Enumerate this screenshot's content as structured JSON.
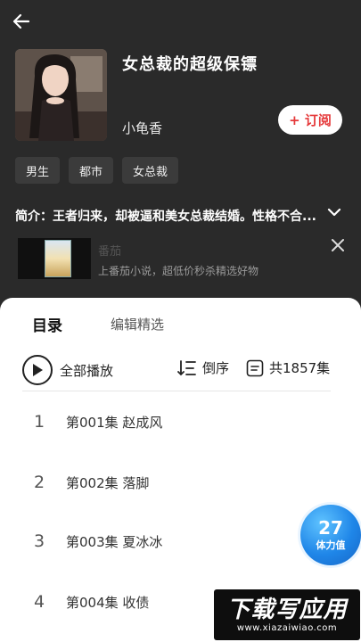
{
  "book": {
    "title": "女总裁的超级保镖",
    "author": "小龟香",
    "subscribe_label": "+ 订阅",
    "tags": [
      "男生",
      "都市",
      "女总裁"
    ],
    "intro": "简介：王者归来，却被逼和美女总裁结婚。性格不合..."
  },
  "ad": {
    "title": "番茄",
    "subtitle": "上番茄小说，超低价秒杀精选好物"
  },
  "sheet": {
    "tabs": [
      "目录",
      "编辑精选"
    ],
    "play_all_label": "全部播放",
    "sort_label": "倒序",
    "count_label": "共1857集",
    "episodes": [
      {
        "num": "1",
        "label": "第001集  赵成风"
      },
      {
        "num": "2",
        "label": "第002集  落脚"
      },
      {
        "num": "3",
        "label": "第003集  夏冰冰"
      },
      {
        "num": "4",
        "label": "第004集  收债"
      }
    ]
  },
  "stamina": {
    "value": "27",
    "label": "体力值"
  },
  "watermark": {
    "main": "下载写应用",
    "url": "www.xiazaiwiao.com"
  },
  "colors": {
    "background": "#2a2a2a",
    "accent_red": "#e5393a",
    "stamina_blue": "#1f86e8"
  },
  "icons": {
    "back": "arrow-left-icon",
    "intro_expand": "chevron-down-icon",
    "ad_close": "close-icon",
    "play": "play-icon",
    "sort": "sort-desc-icon",
    "count": "list-icon"
  }
}
